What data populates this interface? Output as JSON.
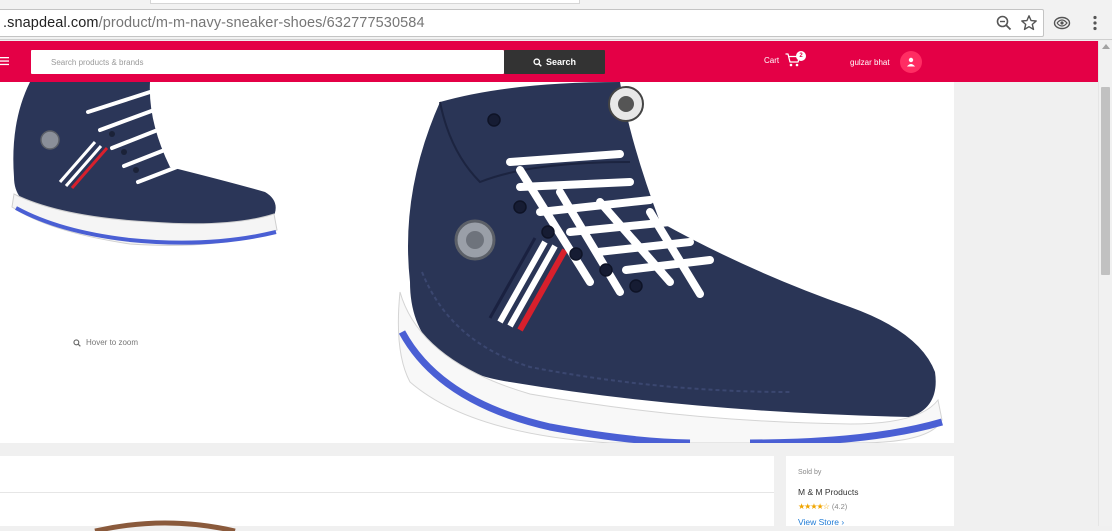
{
  "browser": {
    "url_host": ".snapdeal.com",
    "url_path": "/product/m-m-navy-sneaker-shoes/632777530584"
  },
  "header": {
    "search_placeholder": "Search products & brands",
    "search_label": "Search",
    "cart_label": "Cart",
    "cart_count": "2",
    "user_name": "gulzar bhat"
  },
  "gallery": {
    "zoom_hint": "Hover to zoom"
  },
  "seller": {
    "sold_by_label": "Sold by",
    "name": "M & M Products",
    "stars": "★★★★☆",
    "rating": "(4.2)",
    "view_store": "View Store"
  },
  "colors": {
    "brand": "#e40046",
    "search_button": "#333333",
    "link": "#1f7bd6",
    "shoe_navy": "#2a3556",
    "sole_blue": "#4a5fd4"
  }
}
